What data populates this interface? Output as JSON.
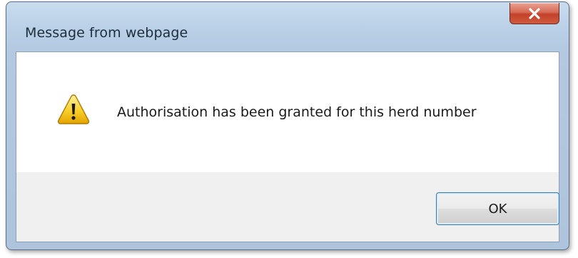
{
  "dialog": {
    "title": "Message from webpage",
    "message": "Authorisation has been granted for this herd number",
    "icon": "warning-icon",
    "ok_label": "OK",
    "close_icon": "close-icon"
  },
  "colors": {
    "titlebar": "#b9cfe6",
    "close_button": "#c2412a",
    "content_bg": "#ffffff",
    "footer_bg": "#f0f0f0",
    "ok_border": "#3c7fb1"
  }
}
